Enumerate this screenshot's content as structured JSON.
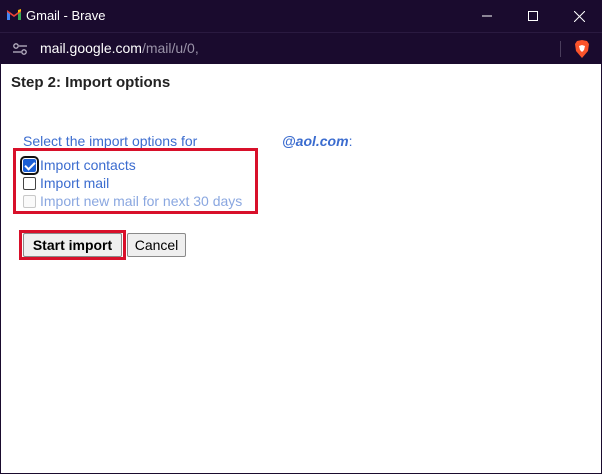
{
  "window": {
    "title": "Gmail - Brave",
    "controls": [
      "minimize-icon",
      "maximize-icon",
      "close-icon"
    ]
  },
  "address_bar": {
    "url_host": "mail.google.com",
    "url_path": "/mail/u/0,"
  },
  "page": {
    "step_title": "Step 2: Import options",
    "intro_text": "Select the import options for",
    "email_domain": "@aol.com",
    "email_suffix": ":",
    "options": [
      {
        "label": "Import contacts",
        "checked": true,
        "disabled": false
      },
      {
        "label": "Import mail",
        "checked": false,
        "disabled": false
      },
      {
        "label": "Import new mail for next 30 days",
        "checked": false,
        "disabled": true
      }
    ],
    "start_button": "Start import",
    "cancel_button": "Cancel"
  },
  "colors": {
    "chrome_bg": "#1a0b2e",
    "link_blue": "#3b6ccf",
    "highlight_red": "#d8102a"
  }
}
